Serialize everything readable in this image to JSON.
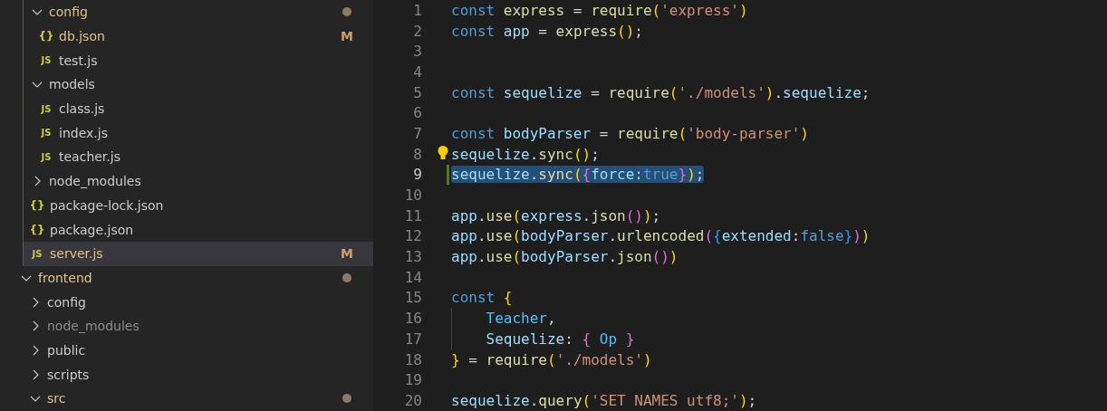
{
  "explorer": {
    "backend_items": [
      {
        "kind": "folder",
        "label": "config",
        "expanded": true,
        "modified": true,
        "ignored": false,
        "dot": true,
        "selected": false,
        "children": [
          {
            "kind": "json",
            "icon": "{}",
            "label": "db.json",
            "modified": true,
            "ignored": false,
            "badge": "M",
            "selected": false
          },
          {
            "kind": "js",
            "icon": "JS",
            "label": "test.js",
            "modified": false,
            "ignored": false,
            "selected": false
          }
        ]
      },
      {
        "kind": "folder",
        "label": "models",
        "expanded": true,
        "modified": false,
        "ignored": false,
        "dot": false,
        "selected": false,
        "children": [
          {
            "kind": "js",
            "icon": "JS",
            "label": "class.js",
            "modified": false,
            "ignored": false,
            "selected": false
          },
          {
            "kind": "js",
            "icon": "JS",
            "label": "index.js",
            "modified": false,
            "ignored": false,
            "selected": false
          },
          {
            "kind": "js",
            "icon": "JS",
            "label": "teacher.js",
            "modified": false,
            "ignored": false,
            "selected": false
          }
        ]
      },
      {
        "kind": "folder",
        "label": "node_modules",
        "expanded": false,
        "modified": false,
        "ignored": false,
        "dot": false,
        "selected": false
      },
      {
        "kind": "json",
        "icon": "{}",
        "label": "package-lock.json",
        "modified": false,
        "ignored": false,
        "selected": false
      },
      {
        "kind": "json",
        "icon": "{}",
        "label": "package.json",
        "modified": false,
        "ignored": false,
        "selected": false
      },
      {
        "kind": "js",
        "icon": "JS",
        "label": "server.js",
        "modified": true,
        "ignored": false,
        "badge": "M",
        "selected": true
      }
    ],
    "items": [
      {
        "kind": "folder",
        "label": "frontend",
        "expanded": true,
        "modified": true,
        "ignored": false,
        "dot": true,
        "selected": false,
        "children": [
          {
            "kind": "folder",
            "label": "config",
            "expanded": false,
            "modified": false,
            "ignored": false,
            "dot": false,
            "selected": false
          },
          {
            "kind": "folder",
            "label": "node_modules",
            "expanded": false,
            "modified": false,
            "ignored": true,
            "dot": false,
            "selected": false
          },
          {
            "kind": "folder",
            "label": "public",
            "expanded": false,
            "modified": false,
            "ignored": false,
            "dot": false,
            "selected": false
          },
          {
            "kind": "folder",
            "label": "scripts",
            "expanded": false,
            "modified": false,
            "ignored": false,
            "dot": false,
            "selected": false
          },
          {
            "kind": "folder",
            "label": "src",
            "expanded": true,
            "modified": true,
            "ignored": false,
            "dot": true,
            "selected": false
          }
        ]
      }
    ]
  },
  "editor": {
    "lines": [
      {
        "number": "1",
        "selected": false,
        "changed": false,
        "lightbulb": false,
        "indent_guide": false,
        "tokens": [
          {
            "kind": "keyword",
            "text": "const"
          },
          {
            "kind": "function",
            "text": " express"
          },
          {
            "kind": "plain",
            "text": " = "
          },
          {
            "kind": "function",
            "text": "require"
          },
          {
            "kind": "bracket1",
            "text": "("
          },
          {
            "kind": "string",
            "text": "'express'"
          },
          {
            "kind": "bracket1",
            "text": ")"
          }
        ]
      },
      {
        "number": "2",
        "selected": false,
        "changed": false,
        "lightbulb": false,
        "indent_guide": false,
        "tokens": [
          {
            "kind": "keyword",
            "text": "const"
          },
          {
            "kind": "variable",
            "text": " app"
          },
          {
            "kind": "plain",
            "text": " = "
          },
          {
            "kind": "function",
            "text": "express"
          },
          {
            "kind": "bracket1",
            "text": "()"
          },
          {
            "kind": "plain",
            "text": ";"
          }
        ]
      },
      {
        "number": "3",
        "selected": false,
        "changed": false,
        "lightbulb": false,
        "indent_guide": false
      },
      {
        "number": "4",
        "selected": false,
        "changed": false,
        "lightbulb": false,
        "indent_guide": false
      },
      {
        "number": "5",
        "selected": false,
        "changed": false,
        "lightbulb": false,
        "indent_guide": false,
        "tokens": [
          {
            "kind": "keyword",
            "text": "const"
          },
          {
            "kind": "variable",
            "text": " sequelize"
          },
          {
            "kind": "plain",
            "text": " = "
          },
          {
            "kind": "function",
            "text": "require"
          },
          {
            "kind": "bracket1",
            "text": "("
          },
          {
            "kind": "string",
            "text": "'./models'"
          },
          {
            "kind": "bracket1",
            "text": ")"
          },
          {
            "kind": "plain",
            "text": "."
          },
          {
            "kind": "variable",
            "text": "sequelize"
          },
          {
            "kind": "plain",
            "text": ";"
          }
        ]
      },
      {
        "number": "6",
        "selected": false,
        "changed": false,
        "lightbulb": false,
        "indent_guide": false
      },
      {
        "number": "7",
        "selected": false,
        "changed": false,
        "lightbulb": false,
        "indent_guide": false,
        "tokens": [
          {
            "kind": "keyword",
            "text": "const"
          },
          {
            "kind": "variable",
            "text": " bodyParser"
          },
          {
            "kind": "plain",
            "text": " = "
          },
          {
            "kind": "function",
            "text": "require"
          },
          {
            "kind": "bracket1",
            "text": "("
          },
          {
            "kind": "string",
            "text": "'body-parser'"
          },
          {
            "kind": "bracket1",
            "text": ")"
          }
        ]
      },
      {
        "number": "8",
        "selected": false,
        "changed": false,
        "lightbulb": true,
        "indent_guide": false,
        "tokens": [
          {
            "kind": "variable",
            "text": "sequelize"
          },
          {
            "kind": "plain",
            "text": "."
          },
          {
            "kind": "function",
            "text": "sync"
          },
          {
            "kind": "bracket1",
            "text": "()"
          },
          {
            "kind": "plain",
            "text": ";"
          }
        ]
      },
      {
        "number": "9",
        "selected": true,
        "changed": true,
        "lightbulb": false,
        "indent_guide": false,
        "tokens": [
          {
            "kind": "variable",
            "text": "sequelize"
          },
          {
            "kind": "plain",
            "text": "."
          },
          {
            "kind": "function",
            "text": "sync"
          },
          {
            "kind": "bracket1",
            "text": "("
          },
          {
            "kind": "bracket2",
            "text": "{"
          },
          {
            "kind": "variable",
            "text": "force"
          },
          {
            "kind": "plain",
            "text": ":"
          },
          {
            "kind": "keyword",
            "text": "true"
          },
          {
            "kind": "bracket2",
            "text": "}"
          },
          {
            "kind": "bracket1",
            "text": ")"
          },
          {
            "kind": "plain",
            "text": ";"
          }
        ]
      },
      {
        "number": "10",
        "selected": false,
        "changed": false,
        "lightbulb": false,
        "indent_guide": false
      },
      {
        "number": "11",
        "selected": false,
        "changed": false,
        "lightbulb": false,
        "indent_guide": false,
        "tokens": [
          {
            "kind": "variable",
            "text": "app"
          },
          {
            "kind": "plain",
            "text": "."
          },
          {
            "kind": "function",
            "text": "use"
          },
          {
            "kind": "bracket1",
            "text": "("
          },
          {
            "kind": "variable",
            "text": "express"
          },
          {
            "kind": "plain",
            "text": "."
          },
          {
            "kind": "function",
            "text": "json"
          },
          {
            "kind": "bracket2",
            "text": "()"
          },
          {
            "kind": "bracket1",
            "text": ")"
          },
          {
            "kind": "plain",
            "text": ";"
          }
        ]
      },
      {
        "number": "12",
        "selected": false,
        "changed": false,
        "lightbulb": false,
        "indent_guide": false,
        "tokens": [
          {
            "kind": "variable",
            "text": "app"
          },
          {
            "kind": "plain",
            "text": "."
          },
          {
            "kind": "function",
            "text": "use"
          },
          {
            "kind": "bracket1",
            "text": "("
          },
          {
            "kind": "variable",
            "text": "bodyParser"
          },
          {
            "kind": "plain",
            "text": "."
          },
          {
            "kind": "function",
            "text": "urlencoded"
          },
          {
            "kind": "bracket2",
            "text": "("
          },
          {
            "kind": "bracket3",
            "text": "{"
          },
          {
            "kind": "variable",
            "text": "extended"
          },
          {
            "kind": "plain",
            "text": ":"
          },
          {
            "kind": "keyword",
            "text": "false"
          },
          {
            "kind": "bracket3",
            "text": "}"
          },
          {
            "kind": "bracket2",
            "text": ")"
          },
          {
            "kind": "bracket1",
            "text": ")"
          }
        ]
      },
      {
        "number": "13",
        "selected": false,
        "changed": false,
        "lightbulb": false,
        "indent_guide": false,
        "tokens": [
          {
            "kind": "variable",
            "text": "app"
          },
          {
            "kind": "plain",
            "text": "."
          },
          {
            "kind": "function",
            "text": "use"
          },
          {
            "kind": "bracket1",
            "text": "("
          },
          {
            "kind": "variable",
            "text": "bodyParser"
          },
          {
            "kind": "plain",
            "text": "."
          },
          {
            "kind": "function",
            "text": "json"
          },
          {
            "kind": "bracket2",
            "text": "()"
          },
          {
            "kind": "bracket1",
            "text": ")"
          }
        ]
      },
      {
        "number": "14",
        "selected": false,
        "changed": false,
        "lightbulb": false,
        "indent_guide": false
      },
      {
        "number": "15",
        "selected": false,
        "changed": false,
        "lightbulb": false,
        "indent_guide": false,
        "tokens": [
          {
            "kind": "keyword",
            "text": "const"
          },
          {
            "kind": "bracket1",
            "text": " {"
          }
        ]
      },
      {
        "number": "16",
        "selected": false,
        "changed": false,
        "lightbulb": false,
        "indent_guide": true,
        "tokens": [
          {
            "kind": "constant",
            "text": "Teacher"
          },
          {
            "kind": "plain",
            "text": ","
          }
        ]
      },
      {
        "number": "17",
        "selected": false,
        "changed": false,
        "lightbulb": false,
        "indent_guide": true,
        "tokens": [
          {
            "kind": "variable",
            "text": "Sequelize"
          },
          {
            "kind": "plain",
            "text": ":"
          },
          {
            "kind": "bracket2",
            "text": " {"
          },
          {
            "kind": "constant",
            "text": " Op"
          },
          {
            "kind": "bracket2",
            "text": " }"
          }
        ]
      },
      {
        "number": "18",
        "selected": false,
        "changed": false,
        "lightbulb": false,
        "indent_guide": false,
        "tokens": [
          {
            "kind": "bracket1",
            "text": "}"
          },
          {
            "kind": "plain",
            "text": " = "
          },
          {
            "kind": "function",
            "text": "require"
          },
          {
            "kind": "bracket1",
            "text": "("
          },
          {
            "kind": "string",
            "text": "'./models'"
          },
          {
            "kind": "bracket1",
            "text": ")"
          }
        ]
      },
      {
        "number": "19",
        "selected": false,
        "changed": false,
        "lightbulb": false,
        "indent_guide": false
      },
      {
        "number": "20",
        "selected": false,
        "changed": false,
        "lightbulb": false,
        "indent_guide": false,
        "tokens": [
          {
            "kind": "variable",
            "text": "sequelize"
          },
          {
            "kind": "plain",
            "text": "."
          },
          {
            "kind": "function",
            "text": "query"
          },
          {
            "kind": "bracket1",
            "text": "("
          },
          {
            "kind": "string",
            "text": "'SET NAMES utf8;'"
          },
          {
            "kind": "bracket1",
            "text": ")"
          },
          {
            "kind": "plain",
            "text": ";"
          }
        ]
      }
    ]
  }
}
